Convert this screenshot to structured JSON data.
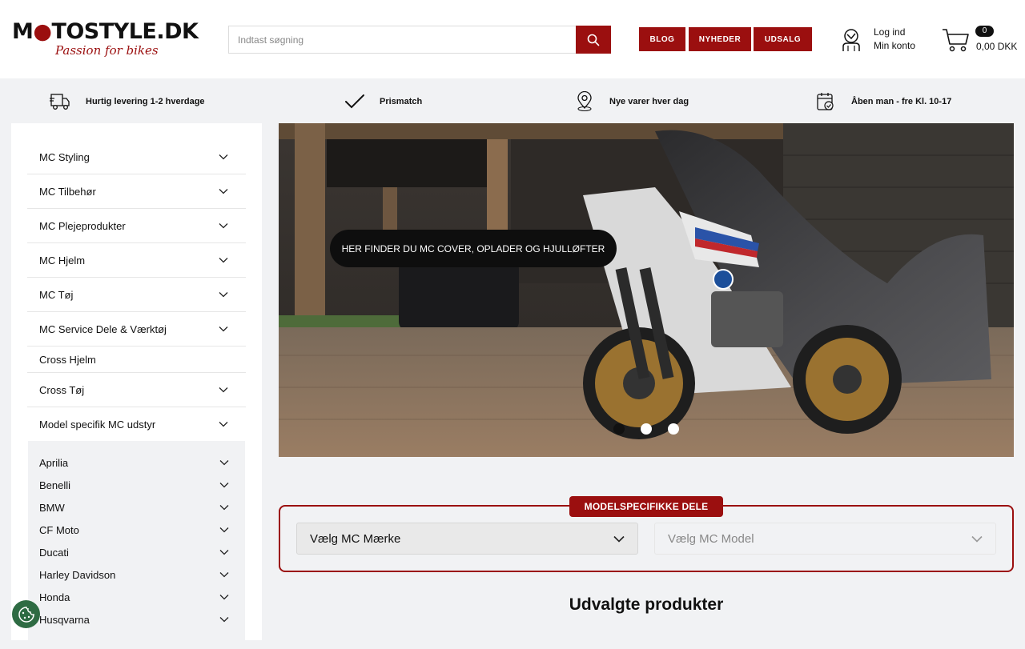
{
  "header": {
    "logo_text_a": "M",
    "logo_text_b": "TOSTYLE.DK",
    "logo_tagline": "Passion for bikes",
    "search_placeholder": "Indtast søgning",
    "nav_buttons": [
      "BLOG",
      "NYHEDER",
      "UDSALG"
    ],
    "account": {
      "login": "Log ind",
      "my_account": "Min konto"
    },
    "cart": {
      "count": "0",
      "total": "0,00 DKK"
    }
  },
  "usps": [
    {
      "icon": "truck-icon",
      "label": "Hurtig levering 1-2 hverdage"
    },
    {
      "icon": "checkmark-icon",
      "label": "Prismatch"
    },
    {
      "icon": "location-pin-icon",
      "label": "Nye varer hver dag"
    },
    {
      "icon": "calendar-check-icon",
      "label": "Åben man - fre Kl. 10-17"
    }
  ],
  "sidebar": {
    "items": [
      {
        "label": "MC Styling",
        "expandable": true
      },
      {
        "label": "MC Tilbehør",
        "expandable": true
      },
      {
        "label": "MC Plejeprodukter",
        "expandable": true
      },
      {
        "label": "MC Hjelm",
        "expandable": true
      },
      {
        "label": "MC Tøj",
        "expandable": true
      },
      {
        "label": "MC Service Dele & Værktøj",
        "expandable": true
      },
      {
        "label": "Cross Hjelm",
        "expandable": false
      },
      {
        "label": "Cross Tøj",
        "expandable": true
      },
      {
        "label": "Model specifik MC udstyr",
        "expandable": true
      }
    ],
    "sub_items": [
      "Aprilia",
      "Benelli",
      "BMW",
      "CF Moto",
      "Ducati",
      "Harley Davidson",
      "Honda",
      "Husqvarna"
    ]
  },
  "hero": {
    "cta": "HER FINDER DU MC COVER, OPLADER OG HJULLØFTER",
    "slides": 3,
    "active_slide": 1
  },
  "model_selector": {
    "title": "MODELSPECIFIKKE DELE",
    "brand_placeholder": "Vælg MC Mærke",
    "model_placeholder": "Vælg MC Model"
  },
  "featured": {
    "title": "Udvalgte produkter"
  },
  "colors": {
    "brand_red": "#9b0f0f",
    "background": "#f1f2f4",
    "cookie_green": "#2e6b43"
  }
}
